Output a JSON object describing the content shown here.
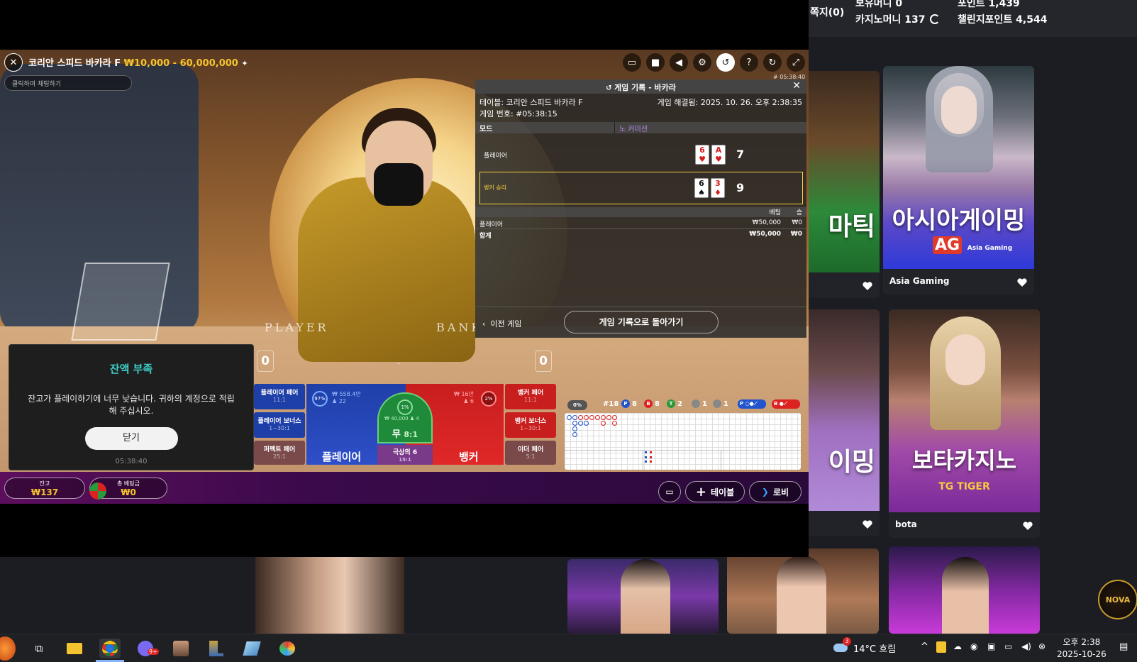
{
  "site_header": {
    "notes": "쪽지(0)",
    "bonus_money": "보유머니 0",
    "casino_money": "카지노머니 137",
    "points": "포인트 1,439",
    "challenge_points": "챌린지포인트 4,544"
  },
  "game_cards": [
    {
      "name": "",
      "art_text": "마틱"
    },
    {
      "name": "Asia Gaming",
      "art_text": "아시아게이밍",
      "logo": "AG",
      "logo_sub": "Asia Gaming"
    },
    {
      "name": "",
      "art_text": "이밍"
    },
    {
      "name": "bota",
      "art_text": "보타카지노",
      "logo": "TG TIGER"
    }
  ],
  "game": {
    "title": "코리안 스피드 바카라 F",
    "limits": "₩10,000 - 60,000,000",
    "chat_placeholder": "클릭하여 채팅하기",
    "round_id": "# 05:38:40",
    "felt_player": "PLAYER",
    "felt_banker": "BANKER",
    "player_score": "0",
    "banker_score": "0"
  },
  "history": {
    "header": "게임 기록 - 바카라",
    "table_label": "테이블: 코리안 스피드 바카라 F",
    "resolved": "게임 해결됨: 2025. 10. 26. 오후 2:38:35",
    "game_number": "게임 번호: #05:38:15",
    "mode_label": "모드",
    "mode_value": "노 커미션",
    "player_label": "플레이어",
    "player_cards": [
      {
        "rank": "6",
        "suit": "♥",
        "color": "red"
      },
      {
        "rank": "A",
        "suit": "♥",
        "color": "red"
      }
    ],
    "player_total": "7",
    "banker_label": "뱅커 승리",
    "banker_cards": [
      {
        "rank": "6",
        "suit": "♠",
        "color": "black"
      },
      {
        "rank": "3",
        "suit": "♦",
        "color": "red"
      }
    ],
    "banker_total": "9",
    "col_bet": "베팅",
    "col_win": "승",
    "rows": [
      {
        "label": "플레이어",
        "bet": "₩50,000",
        "win": "₩0"
      },
      {
        "label": "합계",
        "bet": "₩50,000",
        "win": "₩0"
      }
    ],
    "prev_game": "이전 게임",
    "back_button": "게임 기록으로 돌아가기"
  },
  "betboard": {
    "player_pair": "플레이어 페어",
    "player_pair_odds": "11:1",
    "player_bonus": "플레이어 보너스",
    "player_bonus_odds": "1~30:1",
    "perfect_pair": "퍼펙트 페어",
    "perfect_pair_odds": "25:1",
    "player_main": "플레이어",
    "player_pct": "97%",
    "player_total_bets": "₩ 558.4만",
    "player_count": "22",
    "tie_main": "무",
    "tie_odds": "8:1",
    "tie_total": "₩ 40,000",
    "tie_count": "4",
    "tie_pct": "1%",
    "super6": "극상의 6",
    "super6_odds": "15:1",
    "banker_main": "뱅커",
    "banker_total_bets": "₩ 16만",
    "banker_count": "6",
    "banker_pct": "2%",
    "banker_pair": "뱅커 페어",
    "banker_pair_odds": "11:1",
    "banker_bonus": "뱅커 보너스",
    "banker_bonus_odds": "1~30:1",
    "either_pair": "이더 페어",
    "either_pair_odds": "5:1"
  },
  "road_stats": {
    "toggle": "0%",
    "rounds": "#18",
    "p": "8",
    "b": "8",
    "t": "2",
    "pp": "1",
    "bp": "1",
    "p_label": "P",
    "b_label": "B",
    "t_label": "T"
  },
  "bottom": {
    "balance_label": "잔고",
    "balance": "₩137",
    "total_bet_label": "총 베팅금",
    "total_bet": "₩0",
    "table_button": "테이블",
    "lobby_button": "로비"
  },
  "modal": {
    "title": "잔액 부족",
    "message": "잔고가 플레이하기에 너무 낮습니다. 귀하의 계정으로 적립해 주십시오.",
    "button": "닫기",
    "time": "05:38:40"
  },
  "nova_logo": "NOVA",
  "taskbar": {
    "weather": "14°C  흐림",
    "weather_badge": "3",
    "chrome_badge": "9+",
    "time": "오후 2:38",
    "date": "2025-10-26"
  }
}
